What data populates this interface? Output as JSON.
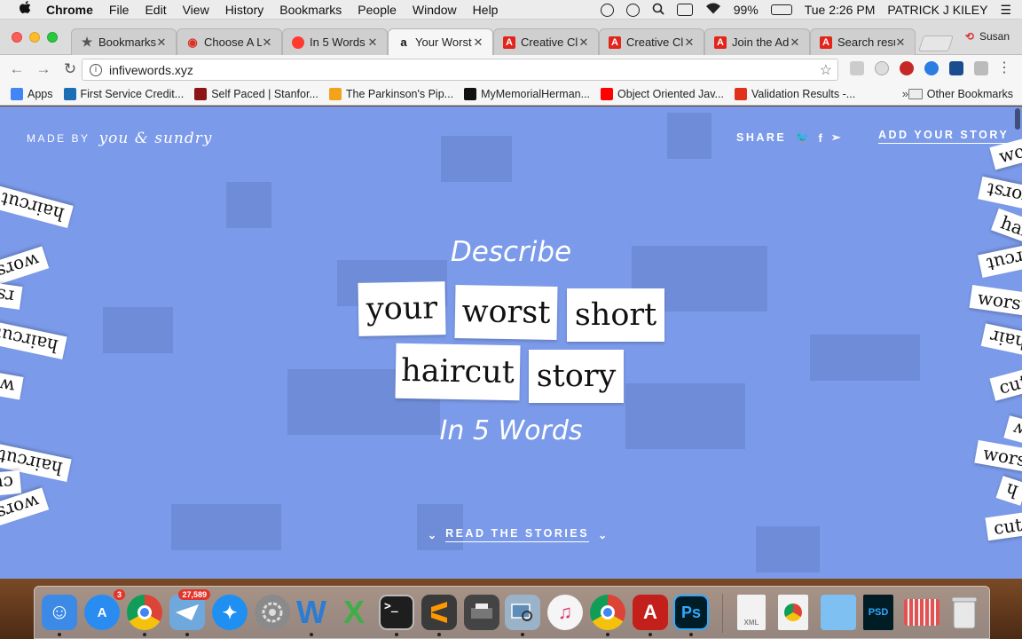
{
  "menubar": {
    "apple": "",
    "app": "Chrome",
    "items": [
      "File",
      "Edit",
      "View",
      "History",
      "Bookmarks",
      "People",
      "Window",
      "Help"
    ],
    "battery": "99%",
    "clock": "Tue 2:26 PM",
    "user": "PATRICK J KILEY",
    "list_icon": "☰"
  },
  "tabs": [
    {
      "label": "Bookmarks",
      "icon": "star-icon",
      "color": "#555555",
      "glyph": "★"
    },
    {
      "label": "Choose A L",
      "icon": "globe-icon",
      "color": "#d9342b",
      "glyph": "◉"
    },
    {
      "label": "In 5 Words",
      "icon": "red-circle-icon",
      "color": "#ff3b30",
      "glyph": ""
    },
    {
      "label": "Your Worst",
      "icon": "amazon-icon",
      "color": "#ffffff",
      "glyph": "a"
    },
    {
      "label": "Creative Cl",
      "icon": "adobe-icon",
      "color": "#e1251b",
      "glyph": "A"
    },
    {
      "label": "Creative Cl",
      "icon": "adobe-icon",
      "color": "#e1251b",
      "glyph": "A"
    },
    {
      "label": "Join the Ad",
      "icon": "adobe-icon",
      "color": "#e1251b",
      "glyph": "A"
    },
    {
      "label": "Search resu",
      "icon": "adobe-icon",
      "color": "#e1251b",
      "glyph": "A"
    }
  ],
  "tab_close": "✕",
  "profile": {
    "icon": "⟲",
    "name": "Susan"
  },
  "toolbar": {
    "back": "←",
    "forward": "→",
    "reload": "↻",
    "info": "i",
    "url": "infivewords.xyz",
    "star": "☆",
    "menu": "⋮"
  },
  "bookmarks": [
    {
      "label": "Apps",
      "color": "#4285f4"
    },
    {
      "label": "First Service Credit...",
      "color": "#1c6fb5"
    },
    {
      "label": "Self Paced | Stanfor...",
      "color": "#8c1515"
    },
    {
      "label": "The Parkinson's Pip...",
      "color": "#f2a31b"
    },
    {
      "label": "MyMemorialHerman...",
      "color": "#111111"
    },
    {
      "label": "Object Oriented Jav...",
      "color": "#ff0000"
    },
    {
      "label": "Validation Results -...",
      "color": "#e0321b"
    }
  ],
  "bookmarks_more": "»",
  "other_bookmarks": "Other Bookmarks",
  "page": {
    "made_by": "MADE BY",
    "made_by_script": "you & sundry",
    "share": "SHARE",
    "twitter": "🐦",
    "facebook": "f",
    "telegram": "➢",
    "add_story": "ADD YOUR STORY",
    "describe": "Describe",
    "words": [
      "your",
      "worst",
      "short",
      "haircut",
      "story"
    ],
    "in5": "In 5 Words",
    "read_stories": "READ THE STORIES",
    "chevron": "⌄",
    "side_words_left": [
      "w",
      "haircut",
      "t",
      "worst",
      "rst",
      "haircut",
      "wor",
      "t",
      "haircut",
      "cut",
      "worst"
    ],
    "side_words_right": [
      "wo",
      "worst",
      "hai",
      "haircut",
      "worst",
      "hair",
      "cut",
      "w",
      "worst",
      "h",
      "cut"
    ]
  },
  "dock": {
    "badge_appstore": "3",
    "badge_mail": "27,589",
    "finder_glyph": "☺",
    "appstore_glyph": "A",
    "safari_glyph": "✦",
    "word_glyph": "W",
    "excel_glyph": "X",
    "terminal_glyph": ">_",
    "acrobat_glyph": "A",
    "ps_glyph": "Ps",
    "psd_glyph": "PSD",
    "xml_glyph": "XML",
    "itunes_glyph": "♫"
  }
}
